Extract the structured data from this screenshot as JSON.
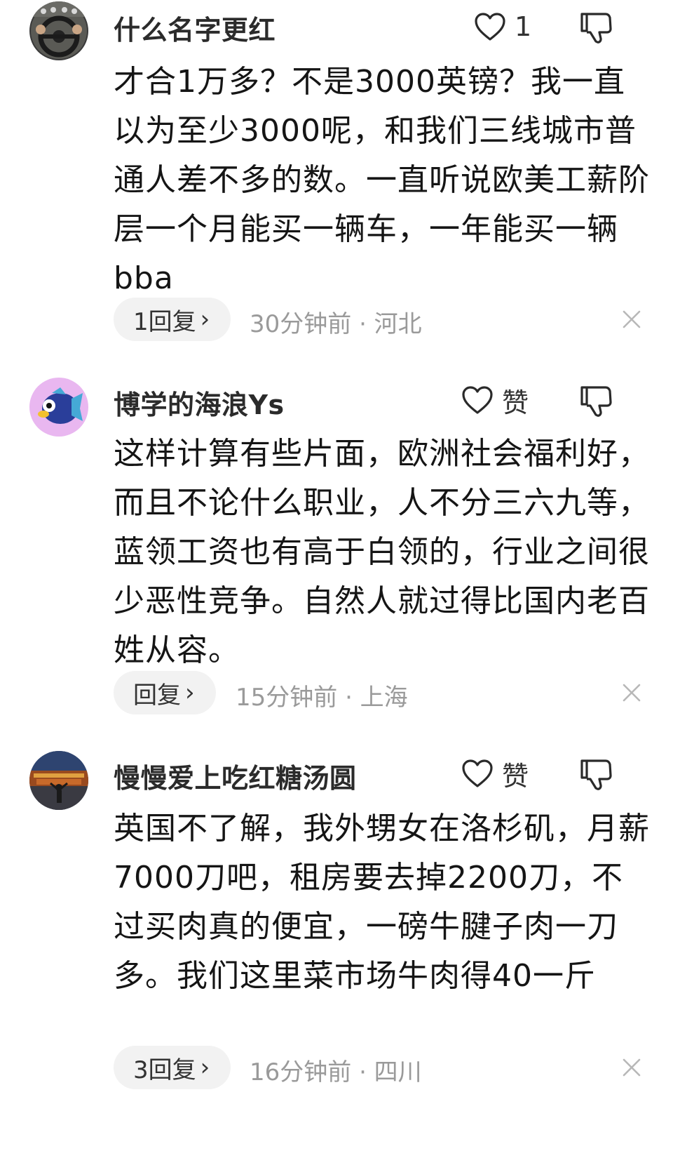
{
  "comments": [
    {
      "username": "什么名字更红",
      "like_label": "1",
      "text": "才合1万多？不是3000英镑？我一直以为至少3000呢，和我们三线城市普通人差不多的数。一直听说欧美工薪阶层一个月能买一辆车，一年能买一辆bba",
      "reply_label": "1回复",
      "meta": "30分钟前 · 河北",
      "avatar_icon": "steering-wheel-avatar"
    },
    {
      "username": "博学的海浪Ys",
      "like_label": "赞",
      "text": "这样计算有些片面，欧洲社会福利好，而且不论什么职业，人不分三六九等，蓝领工资也有高于白领的，行业之间很少恶性竞争。自然人就过得比国内老百姓从容。",
      "reply_label": "回复",
      "meta": "15分钟前 · 上海",
      "avatar_icon": "cartoon-fish-avatar"
    },
    {
      "username": "慢慢爱上吃红糖汤圆",
      "like_label": "赞",
      "text": "英国不了解，我外甥女在洛杉矶，月薪7000刀吧，租房要去掉2200刀，不过买肉真的便宜，一磅牛腱子肉一刀多。我们这里菜市场牛肉得40一斤",
      "reply_label": "3回复",
      "meta": "16分钟前 · 四川",
      "avatar_icon": "night-palace-avatar"
    }
  ],
  "icons": {
    "like": "heart-outline-icon",
    "dislike": "thumbs-down-icon",
    "close": "close-icon",
    "chevron": "chevron-right-icon"
  },
  "colors": {
    "text": "#151515",
    "meta": "#9a9a9a",
    "pill_bg": "#f2f2f2"
  }
}
